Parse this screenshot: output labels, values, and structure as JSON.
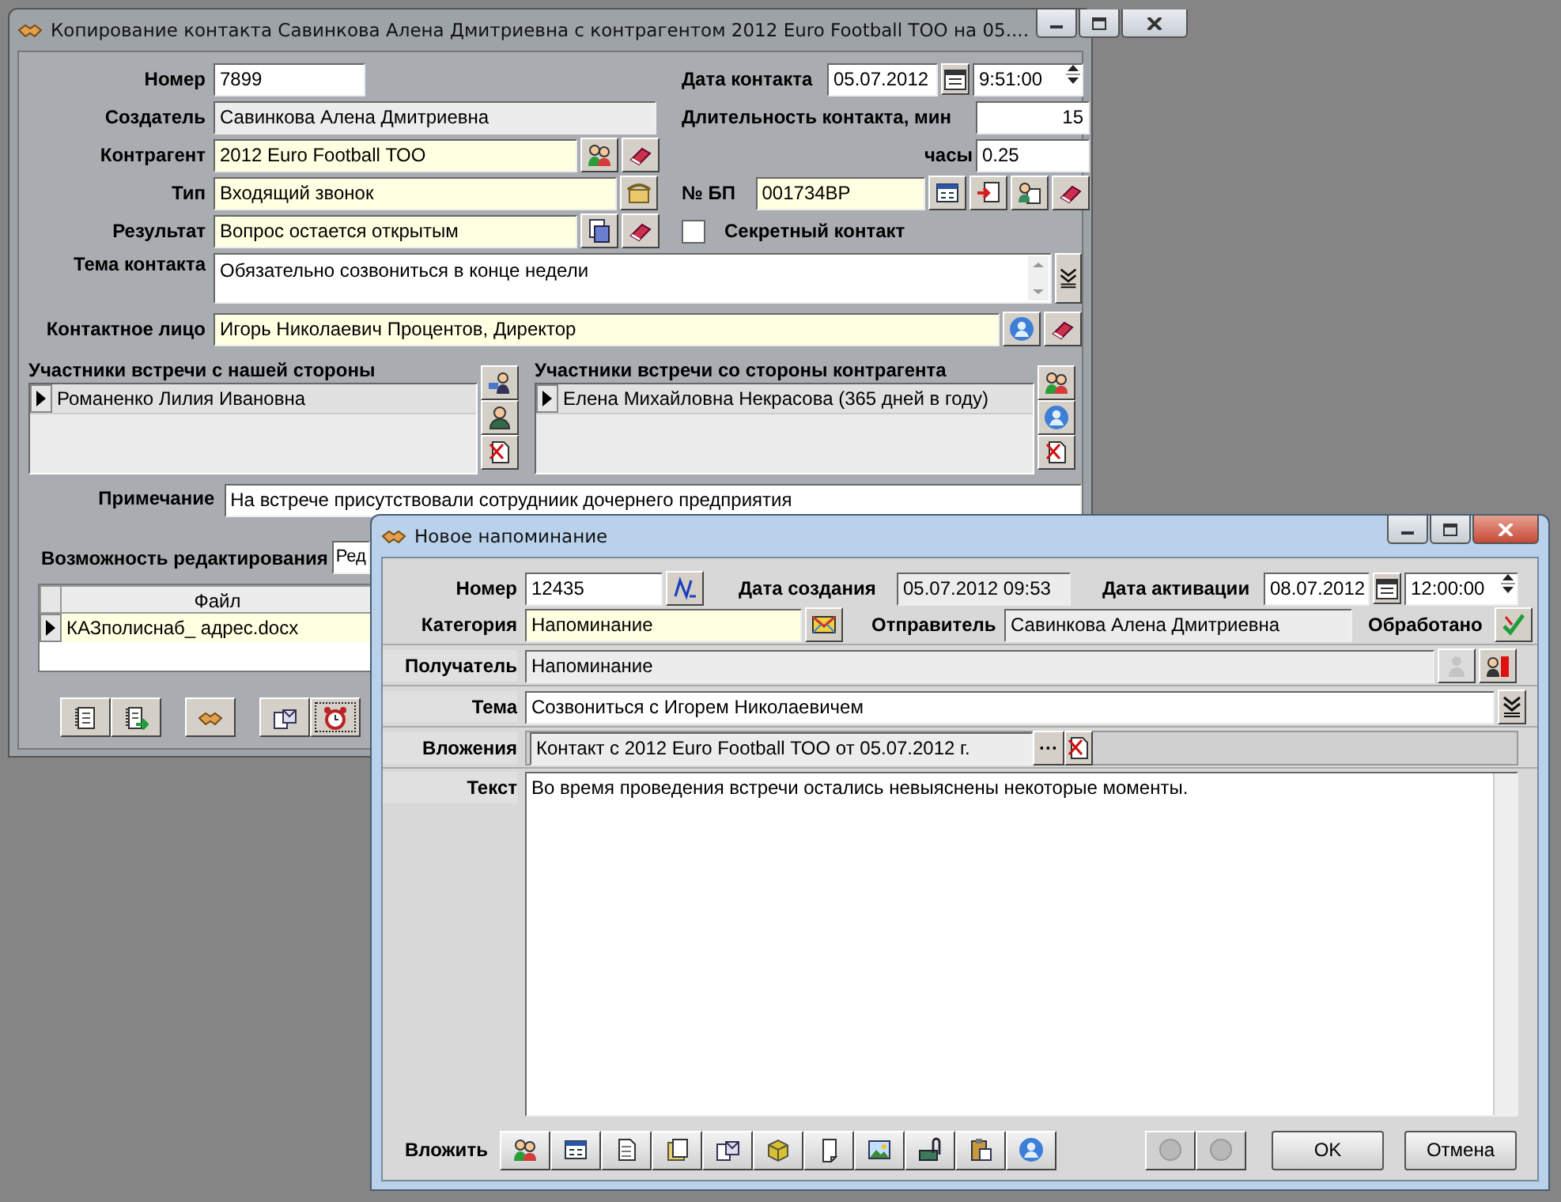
{
  "back_window": {
    "title": "Копирование контакта Савинкова Алена Дмитриевна с контрагентом 2012 Euro Football ТОО на 05....",
    "number": {
      "label": "Номер",
      "value": "7899"
    },
    "creator": {
      "label": "Создатель",
      "value": "Савинкова Алена Дмитриевна"
    },
    "counterparty": {
      "label": "Контрагент",
      "value": "2012 Euro Football ТОО"
    },
    "type": {
      "label": "Тип",
      "value": "Входящий звонок"
    },
    "result": {
      "label": "Результат",
      "value": "Вопрос остается открытым"
    },
    "contact_date": {
      "label": "Дата контакта",
      "date": "05.07.2012",
      "time": "9:51:00"
    },
    "duration": {
      "label": "Длительность контакта, мин",
      "value": "15"
    },
    "hours": {
      "label": "часы",
      "value": "0.25"
    },
    "bp": {
      "label": "№ БП",
      "value": "001734BP"
    },
    "secret": {
      "label": "Секретный контакт",
      "checked": false
    },
    "subject": {
      "label": "Тема контакта",
      "value": "Обязательно созвониться в конце недели"
    },
    "contact_person": {
      "label": "Контактное лицо",
      "value": "Игорь Николаевич Процентов, Директор"
    },
    "our_participants": {
      "title": "Участники встречи с нашей стороны",
      "rows": [
        {
          "name": "Романенко Лилия Ивановна",
          "selected": true
        }
      ]
    },
    "their_participants": {
      "title": "Участники встречи со стороны контрагента",
      "rows": [
        {
          "name": "Елена Михайловна Некрасова (365 дней в году)",
          "selected": true
        }
      ]
    },
    "note": {
      "label": "Примечание",
      "value": "На встрече присутствовали сотрудниик дочернего предприятия"
    },
    "editability": {
      "label": "Возможность редактирования",
      "value": "Ред"
    },
    "files": {
      "columns": [
        "Файл"
      ],
      "rows": [
        {
          "file": "КАЗполиснаб_ адрес.docx",
          "selected": true
        }
      ]
    }
  },
  "front_window": {
    "title": "Новое напоминание",
    "number": {
      "label": "Номер",
      "value": "12435"
    },
    "created": {
      "label": "Дата создания",
      "value": "05.07.2012 09:53"
    },
    "activation": {
      "label": "Дата активации",
      "date": "08.07.2012",
      "time": "12:00:00"
    },
    "category": {
      "label": "Категория",
      "value": "Напоминание"
    },
    "sender": {
      "label": "Отправитель",
      "value": "Савинкова Алена Дмитриевна"
    },
    "processed": {
      "label": "Обработано"
    },
    "recipient": {
      "label": "Получатель",
      "value": "Напоминание"
    },
    "topic": {
      "label": "Тема",
      "value": "Созвониться с Игорем Николаевичем"
    },
    "attachments": {
      "label": "Вложения",
      "value": "Контакт с 2012 Euro Football ТОО от 05.07.2012 г.",
      "browse": "···"
    },
    "text": {
      "label": "Текст",
      "value": "Во время проведения встречи остались невыяснены некоторые моменты."
    },
    "attach": {
      "label": "Вложить"
    },
    "nav_buttons": [
      {
        "disabled": true
      },
      {
        "disabled": true
      }
    ],
    "buttons": [
      "OK",
      "Отмена"
    ]
  }
}
